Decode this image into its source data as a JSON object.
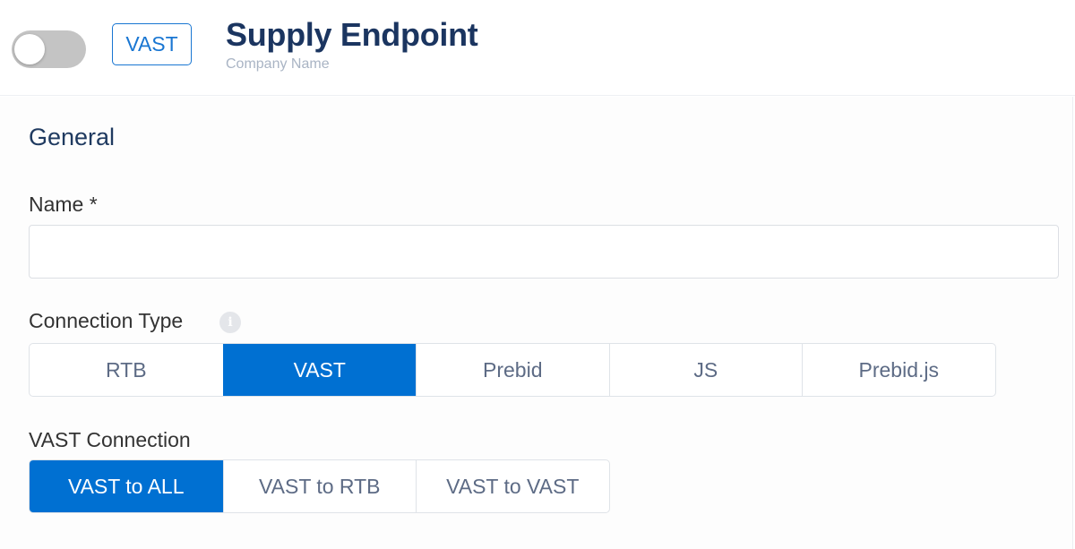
{
  "header": {
    "toggle": {
      "state": "off"
    },
    "type_badge": "VAST",
    "title": "Supply Endpoint",
    "subtitle": "Company Name"
  },
  "general": {
    "section_title": "General",
    "name_field": {
      "label": "Name *",
      "value": "",
      "placeholder": ""
    },
    "connection_type": {
      "label": "Connection Type",
      "info_icon": "info-icon",
      "options": [
        "RTB",
        "VAST",
        "Prebid",
        "JS",
        "Prebid.js"
      ],
      "selected": "VAST"
    },
    "vast_connection": {
      "label": "VAST Connection",
      "options": [
        "VAST to ALL",
        "VAST to RTB",
        "VAST to VAST"
      ],
      "selected": "VAST to ALL"
    }
  },
  "colors": {
    "accent": "#0070d2",
    "title": "#1b3560",
    "toggle_off": "#c4c4c4"
  }
}
